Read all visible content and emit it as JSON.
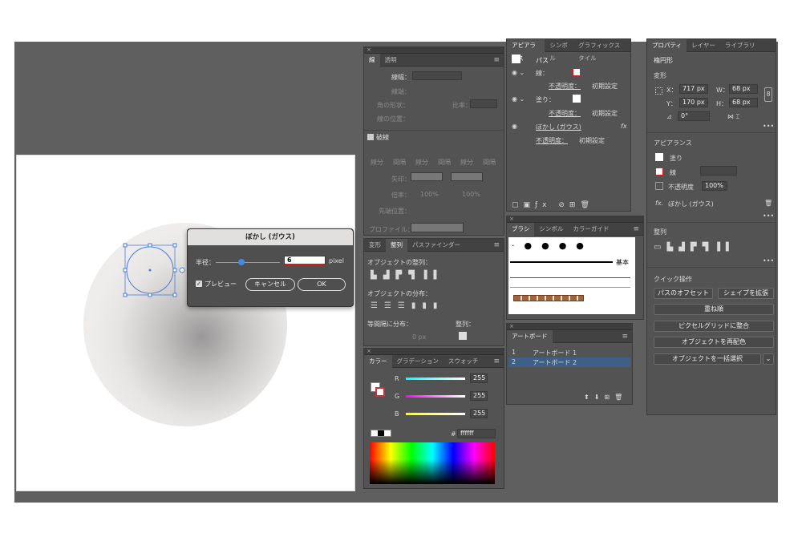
{
  "stroke_panel": {
    "tabs": [
      "線",
      "透明"
    ],
    "labels": [
      "線幅：",
      "線端：",
      "角の形状：",
      "線の位置："
    ],
    "miter_label": "比率：",
    "dashed_label": "破線",
    "dash_headers": [
      "線分",
      "間隔",
      "線分",
      "間隔",
      "線分",
      "間隔"
    ],
    "arrow_label": "矢印：",
    "scale_label": "倍率：",
    "scale_values": [
      "100%",
      "100%"
    ],
    "align_tip_label": "先端位置：",
    "profile_label": "プロファイル："
  },
  "align_panel": {
    "tabs": [
      "変形",
      "整列",
      "パスファインダー"
    ],
    "align_objects": "オブジェクトの整列：",
    "distribute_objects": "オブジェクトの分布：",
    "distribute_spacing": "等間隔に分布：",
    "align_to": "整列：",
    "spacing_value": "0 px"
  },
  "color_panel": {
    "tabs": [
      "カラー",
      "グラデーション",
      "スウォッチ"
    ],
    "channels": [
      {
        "name": "R",
        "value": "255"
      },
      {
        "name": "G",
        "value": "255"
      },
      {
        "name": "B",
        "value": "255"
      }
    ],
    "hex_label": "#",
    "hex_value": "ffffff"
  },
  "appearance_panel": {
    "tabs": [
      "アピアランス",
      "シンボル",
      "グラフィックスタイル"
    ],
    "rows": [
      {
        "label": "パス",
        "value": ""
      },
      {
        "label": "線：",
        "value": ""
      },
      {
        "label": "不透明度：",
        "value": "初期設定"
      },
      {
        "label": "塗り：",
        "value": ""
      },
      {
        "label": "不透明度：",
        "value": "初期設定"
      },
      {
        "label": "ぼかし (ガウス)",
        "value": "fx"
      },
      {
        "label": "不透明度：",
        "value": "初期設定"
      }
    ]
  },
  "brush_panel": {
    "tabs": [
      "ブラシ",
      "シンボル",
      "カラーガイド"
    ],
    "basic_label": "基本"
  },
  "artboard_panel": {
    "title": "アートボード",
    "items": [
      {
        "num": "1",
        "name": "アートボード 1"
      },
      {
        "num": "2",
        "name": "アートボード 2"
      }
    ]
  },
  "properties_panel": {
    "tabs": [
      "プロパティ",
      "レイヤー",
      "ライブラリ"
    ],
    "object_type": "楕円形",
    "transform_label": "変形",
    "x_label": "X：",
    "x_value": "717 px",
    "y_label": "Y：",
    "y_value": "170 px",
    "w_label": "W：",
    "w_value": "68 px",
    "h_label": "H：",
    "h_value": "68 px",
    "angle_value": "0°",
    "appearance_label": "アピアランス",
    "fill_label": "塗り",
    "stroke_label": "線",
    "opacity_label": "不透明度",
    "opacity_value": "100%",
    "effect_label": "ぼかし (ガウス)",
    "align_label": "整列",
    "quick_actions_label": "クイック操作",
    "buttons": [
      "パスのオフセット",
      "シェイプを拡張",
      "重ね順",
      "ピクセルグリッドに整合",
      "オブジェクトを再配色",
      "オブジェクトを一括選択"
    ]
  },
  "blur_dialog": {
    "title": "ぼかし (ガウス)",
    "radius_label": "半径：",
    "radius_value": "6",
    "radius_unit": "pixel",
    "radius_fraction": 0.12,
    "preview_label": "プレビュー",
    "cancel_label": "キャンセル",
    "ok_label": "OK"
  }
}
